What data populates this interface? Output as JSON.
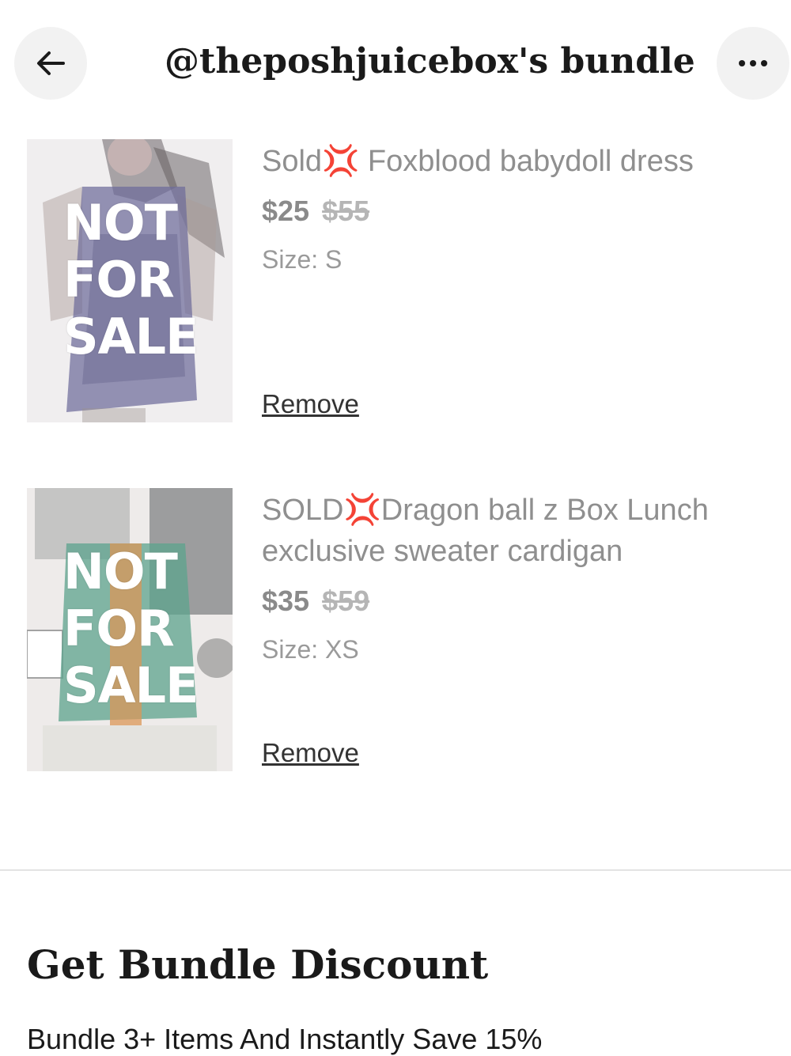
{
  "header": {
    "title": "@theposhjuicebox's bundle",
    "back_icon": "arrow-left-icon",
    "more_icon": "more-horizontal-icon"
  },
  "items": [
    {
      "title": "Sold💢 Foxblood babydoll dress",
      "price": "$25",
      "original_price": "$55",
      "size": "Size: S",
      "overlay": [
        "NOT",
        "FOR",
        "SALE"
      ],
      "remove_label": "Remove"
    },
    {
      "title": "SOLD💢Dragon ball z Box Lunch exclusive sweater cardigan",
      "price": "$35",
      "original_price": "$59",
      "size": "Size: XS",
      "overlay": [
        "NOT",
        "FOR",
        "SALE"
      ],
      "remove_label": "Remove"
    }
  ],
  "discount": {
    "title": "Get Bundle Discount",
    "text": "Bundle 3+ Items And Instantly Save 15%"
  },
  "colors": {
    "accent_text": "#1a1a1a",
    "muted_text": "#8a8a8a",
    "divider": "#e3e3e3"
  }
}
